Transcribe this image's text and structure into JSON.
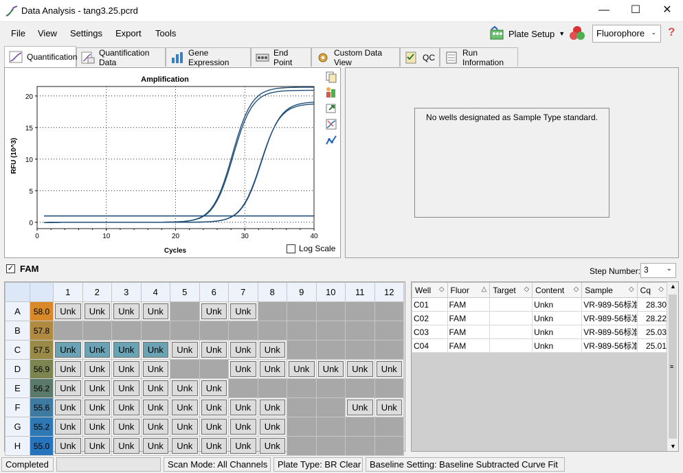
{
  "window": {
    "title": "Data Analysis - tang3.25.pcrd"
  },
  "menu": {
    "items": [
      "File",
      "View",
      "Settings",
      "Export",
      "Tools"
    ],
    "plate_setup": "Plate Setup",
    "fluorophore": "Fluorophore"
  },
  "tabs": [
    "Quantification",
    "Quantification Data",
    "Gene Expression",
    "End Point",
    "Custom Data View",
    "QC",
    "Run Information"
  ],
  "chart_data": {
    "type": "line",
    "title": "Amplification",
    "xlabel": "Cycles",
    "ylabel": "RFU (10^3)",
    "xlim": [
      0,
      40
    ],
    "ylim": [
      -1,
      21.5
    ],
    "xticks": [
      "0",
      "10",
      "20",
      "30",
      "40"
    ],
    "yticks": [
      "0",
      "5",
      "10",
      "15",
      "20"
    ],
    "grid": true,
    "threshold": 1.0,
    "series": [
      {
        "midpoint": 28.3,
        "plateau": 20.9,
        "color": "#1f4e79"
      },
      {
        "midpoint": 28.2,
        "plateau": 21.4,
        "color": "#1f4e79"
      },
      {
        "midpoint": 32.4,
        "plateau": 19.1,
        "color": "#1f4e79"
      },
      {
        "midpoint": 32.3,
        "plateau": 18.8,
        "color": "#1f4e79"
      }
    ]
  },
  "log_scale_label": "Log Scale",
  "standard_message": "No wells designated as Sample Type standard.",
  "fluor_label": "FAM",
  "step_number": {
    "label": "Step Number:",
    "value": "3"
  },
  "plate": {
    "columns": [
      "1",
      "2",
      "3",
      "4",
      "5",
      "6",
      "7",
      "8",
      "9",
      "10",
      "11",
      "12"
    ],
    "rows": [
      {
        "label": "A",
        "temp": "58.0",
        "color": "#d9882a",
        "wells": [
          "Unk",
          "Unk",
          "Unk",
          "Unk",
          "",
          "Unk",
          "Unk",
          "",
          "",
          "",
          "",
          ""
        ]
      },
      {
        "label": "B",
        "temp": "57.8",
        "color": "#b08a40",
        "wells": [
          "",
          "",
          "",
          "",
          "",
          "",
          "",
          "",
          "",
          "",
          "",
          ""
        ]
      },
      {
        "label": "C",
        "temp": "57.5",
        "color": "#9a8a48",
        "wells": [
          "Unk",
          "Unk",
          "Unk",
          "Unk",
          "Unk",
          "Unk",
          "Unk",
          "Unk",
          "",
          "",
          "",
          ""
        ]
      },
      {
        "label": "D",
        "temp": "56.9",
        "color": "#7c8450",
        "wells": [
          "Unk",
          "Unk",
          "Unk",
          "Unk",
          "",
          "",
          "Unk",
          "Unk",
          "Unk",
          "Unk",
          "Unk",
          "Unk"
        ]
      },
      {
        "label": "E",
        "temp": "56.2",
        "color": "#5c7a6c",
        "wells": [
          "Unk",
          "Unk",
          "Unk",
          "Unk",
          "Unk",
          "Unk",
          "",
          "",
          "",
          "",
          "",
          ""
        ]
      },
      {
        "label": "F",
        "temp": "55.6",
        "color": "#3f7aa0",
        "wells": [
          "Unk",
          "Unk",
          "Unk",
          "Unk",
          "Unk",
          "Unk",
          "Unk",
          "Unk",
          "",
          "",
          "Unk",
          "Unk"
        ]
      },
      {
        "label": "G",
        "temp": "55.2",
        "color": "#2f78b6",
        "wells": [
          "Unk",
          "Unk",
          "Unk",
          "Unk",
          "Unk",
          "Unk",
          "Unk",
          "Unk",
          "",
          "",
          "",
          ""
        ]
      },
      {
        "label": "H",
        "temp": "55.0",
        "color": "#2674bd",
        "wells": [
          "Unk",
          "Unk",
          "Unk",
          "Unk",
          "Unk",
          "Unk",
          "Unk",
          "Unk",
          "",
          "",
          "",
          ""
        ]
      }
    ],
    "selected": [
      "C1",
      "C2",
      "C3",
      "C4"
    ]
  },
  "grid": {
    "headers": [
      "Well",
      "Fluor",
      "Target",
      "Content",
      "Sample",
      "Cq"
    ],
    "rows": [
      [
        "C01",
        "FAM",
        "",
        "Unkn",
        "VR-989-56标准",
        "28.30"
      ],
      [
        "C02",
        "FAM",
        "",
        "Unkn",
        "VR-989-56标准",
        "28.22"
      ],
      [
        "C03",
        "FAM",
        "",
        "Unkn",
        "VR-989-56标准",
        "25.03"
      ],
      [
        "C04",
        "FAM",
        "",
        "Unkn",
        "VR-989-56标准",
        "25.01"
      ]
    ]
  },
  "status": {
    "state": "Completed",
    "scan_mode": "Scan Mode: All Channels",
    "plate_type": "Plate Type: BR Clear",
    "baseline": "Baseline Setting: Baseline Subtracted Curve Fit"
  }
}
